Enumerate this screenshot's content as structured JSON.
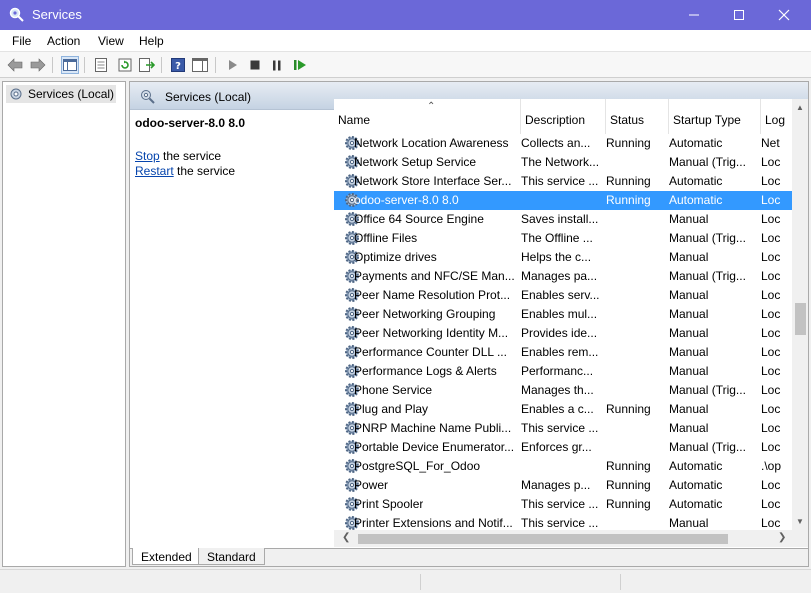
{
  "window": {
    "title": "Services"
  },
  "menu": [
    "File",
    "Action",
    "View",
    "Help"
  ],
  "tree": {
    "root_label": "Services (Local)"
  },
  "pane": {
    "header_title": "Services (Local)",
    "selected_service": "odoo-server-8.0 8.0",
    "stop_link": "Stop",
    "stop_suffix": " the service",
    "restart_link": "Restart",
    "restart_suffix": " the service"
  },
  "columns": [
    "Name",
    "Description",
    "Status",
    "Startup Type",
    "Log"
  ],
  "services": [
    {
      "name": "Network Location Awareness",
      "description": "Collects an...",
      "status": "Running",
      "startup": "Automatic",
      "logon": "Net"
    },
    {
      "name": "Network Setup Service",
      "description": "The Network...",
      "status": "",
      "startup": "Manual (Trig...",
      "logon": "Loc"
    },
    {
      "name": "Network Store Interface Ser...",
      "description": "This service ...",
      "status": "Running",
      "startup": "Automatic",
      "logon": "Loc"
    },
    {
      "name": "odoo-server-8.0 8.0",
      "description": "",
      "status": "Running",
      "startup": "Automatic",
      "logon": "Loc",
      "selected": true
    },
    {
      "name": "Office 64 Source Engine",
      "description": "Saves install...",
      "status": "",
      "startup": "Manual",
      "logon": "Loc"
    },
    {
      "name": "Offline Files",
      "description": "The Offline ...",
      "status": "",
      "startup": "Manual (Trig...",
      "logon": "Loc"
    },
    {
      "name": "Optimize drives",
      "description": "Helps the c...",
      "status": "",
      "startup": "Manual",
      "logon": "Loc"
    },
    {
      "name": "Payments and NFC/SE Man...",
      "description": "Manages pa...",
      "status": "",
      "startup": "Manual (Trig...",
      "logon": "Loc"
    },
    {
      "name": "Peer Name Resolution Prot...",
      "description": "Enables serv...",
      "status": "",
      "startup": "Manual",
      "logon": "Loc"
    },
    {
      "name": "Peer Networking Grouping",
      "description": "Enables mul...",
      "status": "",
      "startup": "Manual",
      "logon": "Loc"
    },
    {
      "name": "Peer Networking Identity M...",
      "description": "Provides ide...",
      "status": "",
      "startup": "Manual",
      "logon": "Loc"
    },
    {
      "name": "Performance Counter DLL ...",
      "description": "Enables rem...",
      "status": "",
      "startup": "Manual",
      "logon": "Loc"
    },
    {
      "name": "Performance Logs & Alerts",
      "description": "Performanc...",
      "status": "",
      "startup": "Manual",
      "logon": "Loc"
    },
    {
      "name": "Phone Service",
      "description": "Manages th...",
      "status": "",
      "startup": "Manual (Trig...",
      "logon": "Loc"
    },
    {
      "name": "Plug and Play",
      "description": "Enables a c...",
      "status": "Running",
      "startup": "Manual",
      "logon": "Loc"
    },
    {
      "name": "PNRP Machine Name Publi...",
      "description": "This service ...",
      "status": "",
      "startup": "Manual",
      "logon": "Loc"
    },
    {
      "name": "Portable Device Enumerator...",
      "description": "Enforces gr...",
      "status": "",
      "startup": "Manual (Trig...",
      "logon": "Loc"
    },
    {
      "name": "PostgreSQL_For_Odoo",
      "description": "",
      "status": "Running",
      "startup": "Automatic",
      "logon": ".\\op"
    },
    {
      "name": "Power",
      "description": "Manages p...",
      "status": "Running",
      "startup": "Automatic",
      "logon": "Loc"
    },
    {
      "name": "Print Spooler",
      "description": "This service ...",
      "status": "Running",
      "startup": "Automatic",
      "logon": "Loc"
    },
    {
      "name": "Printer Extensions and Notif...",
      "description": "This service ...",
      "status": "",
      "startup": "Manual",
      "logon": "Loc"
    }
  ],
  "tabs": [
    "Extended",
    "Standard"
  ],
  "colors": {
    "titlebar": "#6b68d8",
    "selection": "#3399ff",
    "link": "#0645ad"
  },
  "icons": {
    "app": "gear-magnifier-icon",
    "service": "gear-icon"
  }
}
